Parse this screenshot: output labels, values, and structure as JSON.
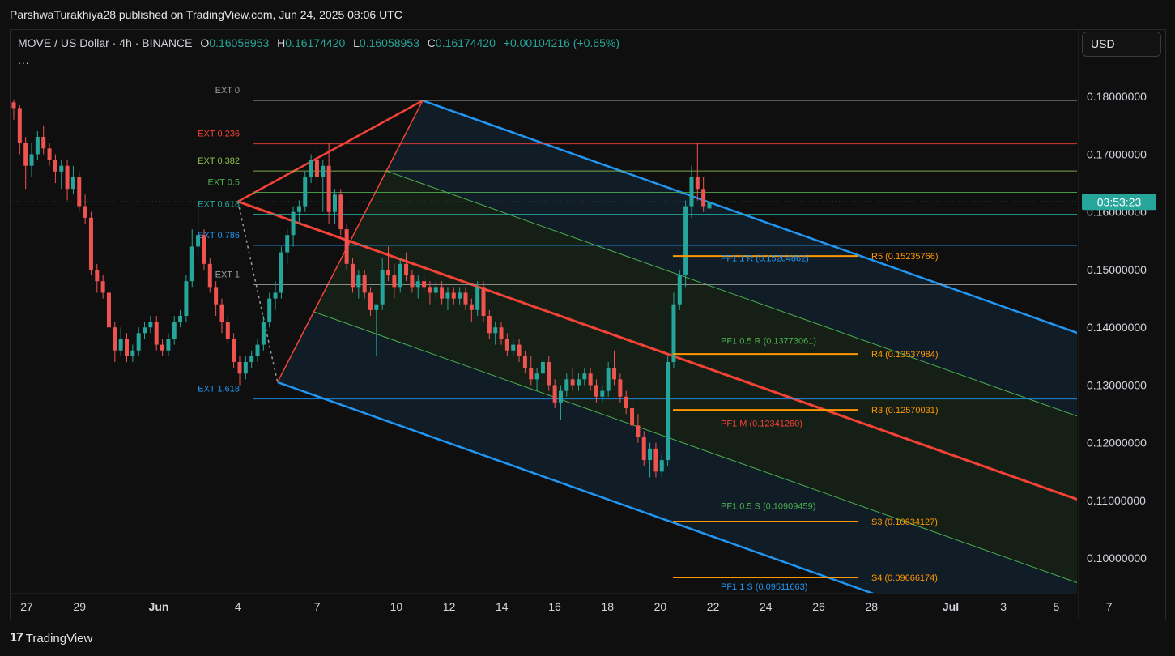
{
  "header": {
    "published_text": "ParshwaTurakhiya28 published on TradingView.com, Jun 24, 2025 08:06 UTC"
  },
  "legend": {
    "symbol": "MOVE / US Dollar · 4h · BINANCE",
    "open_key": "O",
    "open": "0.16058953",
    "high_key": "H",
    "high": "0.16174420",
    "low_key": "L",
    "low": "0.16058953",
    "close_key": "C",
    "close": "0.16174420",
    "change": "+0.00104216 (+0.65%)",
    "more": "..."
  },
  "currency_button": "USD",
  "footer": {
    "logo_mark": "17",
    "brand": "TradingView"
  },
  "colors": {
    "up": "#26a69a",
    "down": "#ef5350",
    "channel_blue": "#2196f3",
    "median_red": "#f44336",
    "mid_green": "#4caf50",
    "pivot_orange": "#ff9800",
    "fib_gray": "#9e9e9e"
  },
  "chart_data": {
    "type": "candlestick",
    "ylim": [
      0.094,
      0.1855
    ],
    "y_ticks": [
      "0.18000000",
      "0.17000000",
      "0.16000000",
      "0.15000000",
      "0.14000000",
      "0.13000000",
      "0.12000000",
      "0.11000000",
      "0.10000000"
    ],
    "y_tick_values": [
      0.18,
      0.17,
      0.16,
      0.15,
      0.14,
      0.13,
      0.12,
      0.11,
      0.1
    ],
    "x_ticks": [
      {
        "label": "27",
        "date": "2025-05-27"
      },
      {
        "label": "29",
        "date": "2025-05-29"
      },
      {
        "label": "Jun",
        "date": "2025-06-01"
      },
      {
        "label": "4",
        "date": "2025-06-04"
      },
      {
        "label": "7",
        "date": "2025-06-07"
      },
      {
        "label": "10",
        "date": "2025-06-10"
      },
      {
        "label": "12",
        "date": "2025-06-12"
      },
      {
        "label": "14",
        "date": "2025-06-14"
      },
      {
        "label": "16",
        "date": "2025-06-16"
      },
      {
        "label": "18",
        "date": "2025-06-18"
      },
      {
        "label": "20",
        "date": "2025-06-20"
      },
      {
        "label": "22",
        "date": "2025-06-22"
      },
      {
        "label": "24",
        "date": "2025-06-24"
      },
      {
        "label": "26",
        "date": "2025-06-26"
      },
      {
        "label": "28",
        "date": "2025-06-28"
      },
      {
        "label": "Jul",
        "date": "2025-07-01"
      },
      {
        "label": "3",
        "date": "2025-07-03"
      },
      {
        "label": "5",
        "date": "2025-07-05"
      },
      {
        "label": "7",
        "date": "2025-07-07"
      }
    ],
    "price_badge": {
      "value": 0.1617442,
      "label": "03:53:23"
    },
    "fib_levels": [
      {
        "label": "EXT 0",
        "value": 0.1793,
        "color": "#9e9e9e"
      },
      {
        "label": "EXT 0.236",
        "value": 0.1718,
        "color": "#f44336"
      },
      {
        "label": "EXT 0.382",
        "value": 0.1671,
        "color": "#8bc34a"
      },
      {
        "label": "EXT 0.5",
        "value": 0.1634,
        "color": "#4caf50"
      },
      {
        "label": "EXT 0.618",
        "value": 0.1596,
        "color": "#26a69a"
      },
      {
        "label": "EXT 0.786",
        "value": 0.1542,
        "color": "#2196f3"
      },
      {
        "label": "EXT 1",
        "value": 0.1474,
        "color": "#9e9e9e"
      },
      {
        "label": "EXT 1.618",
        "value": 0.1276,
        "color": "#2196f3"
      }
    ],
    "pivots": [
      {
        "label": "R5 (0.15235766)",
        "value": 0.15235766
      },
      {
        "label": "R4 (0.13537984)",
        "value": 0.13537984
      },
      {
        "label": "R3 (0.12570031)",
        "value": 0.12570031
      },
      {
        "label": "S3 (0.10634127)",
        "value": 0.10634127
      },
      {
        "label": "S4 (0.09666174)",
        "value": 0.09666174
      }
    ],
    "pitchfork_labels": [
      {
        "label": "PF1 1 R (0.15204862)",
        "value": 0.15204862,
        "color": "#2196f3"
      },
      {
        "label": "PF1 0.5 R (0.13773061)",
        "value": 0.13773061,
        "color": "#4caf50"
      },
      {
        "label": "PF1 M (0.12341260)",
        "value": 0.1234126,
        "color": "#f44336"
      },
      {
        "label": "PF1 0.5 S (0.10909459)",
        "value": 0.10909459,
        "color": "#4caf50"
      },
      {
        "label": "PF1 1 S (0.09511663)",
        "value": 0.09511663,
        "color": "#2196f3"
      }
    ],
    "pitchfork_points": [
      {
        "date": "2025-06-04T00:00",
        "price": 0.1618
      },
      {
        "date": "2025-06-11T00:00",
        "price": 0.1793
      },
      {
        "date": "2025-06-05T12:00",
        "price": 0.1305
      }
    ],
    "candles_ohlc": [
      [
        0.179,
        0.1795,
        0.176,
        0.178
      ],
      [
        0.178,
        0.1785,
        0.17,
        0.172
      ],
      [
        0.172,
        0.173,
        0.164,
        0.168
      ],
      [
        0.168,
        0.172,
        0.166,
        0.17
      ],
      [
        0.17,
        0.174,
        0.169,
        0.173
      ],
      [
        0.173,
        0.175,
        0.17,
        0.171
      ],
      [
        0.171,
        0.172,
        0.168,
        0.169
      ],
      [
        0.169,
        0.17,
        0.165,
        0.167
      ],
      [
        0.167,
        0.169,
        0.164,
        0.168
      ],
      [
        0.168,
        0.169,
        0.162,
        0.164
      ],
      [
        0.164,
        0.168,
        0.163,
        0.166
      ],
      [
        0.166,
        0.167,
        0.16,
        0.161
      ],
      [
        0.161,
        0.163,
        0.158,
        0.159
      ],
      [
        0.159,
        0.16,
        0.149,
        0.15
      ],
      [
        0.15,
        0.151,
        0.146,
        0.148
      ],
      [
        0.148,
        0.149,
        0.145,
        0.146
      ],
      [
        0.146,
        0.147,
        0.139,
        0.14
      ],
      [
        0.14,
        0.141,
        0.134,
        0.136
      ],
      [
        0.136,
        0.14,
        0.135,
        0.138
      ],
      [
        0.138,
        0.139,
        0.134,
        0.135
      ],
      [
        0.135,
        0.137,
        0.134,
        0.136
      ],
      [
        0.136,
        0.14,
        0.135,
        0.139
      ],
      [
        0.139,
        0.141,
        0.138,
        0.14
      ],
      [
        0.14,
        0.142,
        0.139,
        0.141
      ],
      [
        0.141,
        0.142,
        0.136,
        0.137
      ],
      [
        0.137,
        0.138,
        0.135,
        0.136
      ],
      [
        0.136,
        0.139,
        0.135,
        0.138
      ],
      [
        0.138,
        0.142,
        0.137,
        0.141
      ],
      [
        0.141,
        0.143,
        0.14,
        0.142
      ],
      [
        0.142,
        0.149,
        0.141,
        0.148
      ],
      [
        0.148,
        0.157,
        0.147,
        0.154
      ],
      [
        0.154,
        0.162,
        0.152,
        0.156
      ],
      [
        0.156,
        0.157,
        0.15,
        0.151
      ],
      [
        0.151,
        0.152,
        0.146,
        0.147
      ],
      [
        0.147,
        0.148,
        0.142,
        0.144
      ],
      [
        0.144,
        0.145,
        0.139,
        0.141
      ],
      [
        0.141,
        0.142,
        0.137,
        0.138
      ],
      [
        0.138,
        0.139,
        0.133,
        0.134
      ],
      [
        0.134,
        0.135,
        0.13,
        0.132
      ],
      [
        0.132,
        0.135,
        0.131,
        0.134
      ],
      [
        0.134,
        0.136,
        0.133,
        0.135
      ],
      [
        0.135,
        0.138,
        0.134,
        0.137
      ],
      [
        0.137,
        0.142,
        0.136,
        0.141
      ],
      [
        0.141,
        0.146,
        0.14,
        0.145
      ],
      [
        0.145,
        0.148,
        0.143,
        0.146
      ],
      [
        0.146,
        0.154,
        0.145,
        0.153
      ],
      [
        0.153,
        0.157,
        0.151,
        0.156
      ],
      [
        0.156,
        0.161,
        0.154,
        0.16
      ],
      [
        0.16,
        0.162,
        0.158,
        0.161
      ],
      [
        0.161,
        0.167,
        0.16,
        0.166
      ],
      [
        0.166,
        0.17,
        0.165,
        0.169
      ],
      [
        0.169,
        0.171,
        0.164,
        0.166
      ],
      [
        0.166,
        0.169,
        0.16,
        0.168
      ],
      [
        0.168,
        0.172,
        0.158,
        0.16
      ],
      [
        0.16,
        0.164,
        0.158,
        0.163
      ],
      [
        0.163,
        0.164,
        0.156,
        0.157
      ],
      [
        0.157,
        0.158,
        0.15,
        0.151
      ],
      [
        0.151,
        0.152,
        0.146,
        0.147
      ],
      [
        0.147,
        0.15,
        0.145,
        0.149
      ],
      [
        0.149,
        0.15,
        0.145,
        0.146
      ],
      [
        0.146,
        0.147,
        0.142,
        0.143
      ],
      [
        0.143,
        0.144,
        0.135,
        0.144
      ],
      [
        0.144,
        0.152,
        0.143,
        0.15
      ],
      [
        0.15,
        0.154,
        0.148,
        0.149
      ],
      [
        0.149,
        0.151,
        0.145,
        0.147
      ],
      [
        0.147,
        0.152,
        0.146,
        0.151
      ],
      [
        0.151,
        0.153,
        0.148,
        0.149
      ],
      [
        0.149,
        0.15,
        0.146,
        0.147
      ],
      [
        0.147,
        0.149,
        0.145,
        0.148
      ],
      [
        0.148,
        0.149,
        0.146,
        0.147
      ],
      [
        0.147,
        0.148,
        0.144,
        0.146
      ],
      [
        0.146,
        0.148,
        0.145,
        0.147
      ],
      [
        0.147,
        0.148,
        0.144,
        0.145
      ],
      [
        0.145,
        0.147,
        0.143,
        0.146
      ],
      [
        0.146,
        0.147,
        0.144,
        0.145
      ],
      [
        0.145,
        0.147,
        0.144,
        0.146
      ],
      [
        0.146,
        0.147,
        0.143,
        0.144
      ],
      [
        0.144,
        0.145,
        0.141,
        0.143
      ],
      [
        0.143,
        0.148,
        0.142,
        0.147
      ],
      [
        0.147,
        0.148,
        0.141,
        0.142
      ],
      [
        0.142,
        0.143,
        0.138,
        0.139
      ],
      [
        0.139,
        0.141,
        0.137,
        0.14
      ],
      [
        0.14,
        0.141,
        0.137,
        0.138
      ],
      [
        0.138,
        0.139,
        0.135,
        0.136
      ],
      [
        0.136,
        0.138,
        0.135,
        0.137
      ],
      [
        0.137,
        0.138,
        0.134,
        0.135
      ],
      [
        0.135,
        0.136,
        0.132,
        0.133
      ],
      [
        0.133,
        0.135,
        0.13,
        0.131
      ],
      [
        0.131,
        0.133,
        0.129,
        0.132
      ],
      [
        0.132,
        0.135,
        0.131,
        0.134
      ],
      [
        0.134,
        0.135,
        0.129,
        0.13
      ],
      [
        0.13,
        0.131,
        0.126,
        0.127
      ],
      [
        0.127,
        0.13,
        0.124,
        0.129
      ],
      [
        0.129,
        0.132,
        0.128,
        0.131
      ],
      [
        0.131,
        0.133,
        0.129,
        0.13
      ],
      [
        0.13,
        0.132,
        0.129,
        0.131
      ],
      [
        0.131,
        0.133,
        0.13,
        0.132
      ],
      [
        0.132,
        0.133,
        0.129,
        0.13
      ],
      [
        0.13,
        0.131,
        0.127,
        0.128
      ],
      [
        0.128,
        0.13,
        0.127,
        0.129
      ],
      [
        0.129,
        0.134,
        0.128,
        0.133
      ],
      [
        0.133,
        0.136,
        0.13,
        0.131
      ],
      [
        0.131,
        0.132,
        0.127,
        0.128
      ],
      [
        0.128,
        0.129,
        0.125,
        0.126
      ],
      [
        0.126,
        0.127,
        0.122,
        0.123
      ],
      [
        0.123,
        0.125,
        0.12,
        0.121
      ],
      [
        0.121,
        0.122,
        0.116,
        0.117
      ],
      [
        0.117,
        0.12,
        0.114,
        0.119
      ],
      [
        0.119,
        0.12,
        0.114,
        0.115
      ],
      [
        0.115,
        0.118,
        0.114,
        0.117
      ],
      [
        0.117,
        0.135,
        0.116,
        0.134
      ],
      [
        0.134,
        0.146,
        0.133,
        0.144
      ],
      [
        0.144,
        0.15,
        0.143,
        0.149
      ],
      [
        0.149,
        0.162,
        0.147,
        0.161
      ],
      [
        0.161,
        0.168,
        0.159,
        0.166
      ],
      [
        0.166,
        0.172,
        0.162,
        0.164
      ],
      [
        0.164,
        0.166,
        0.16,
        0.161
      ],
      [
        0.1606,
        0.1617,
        0.1606,
        0.1617
      ]
    ]
  }
}
